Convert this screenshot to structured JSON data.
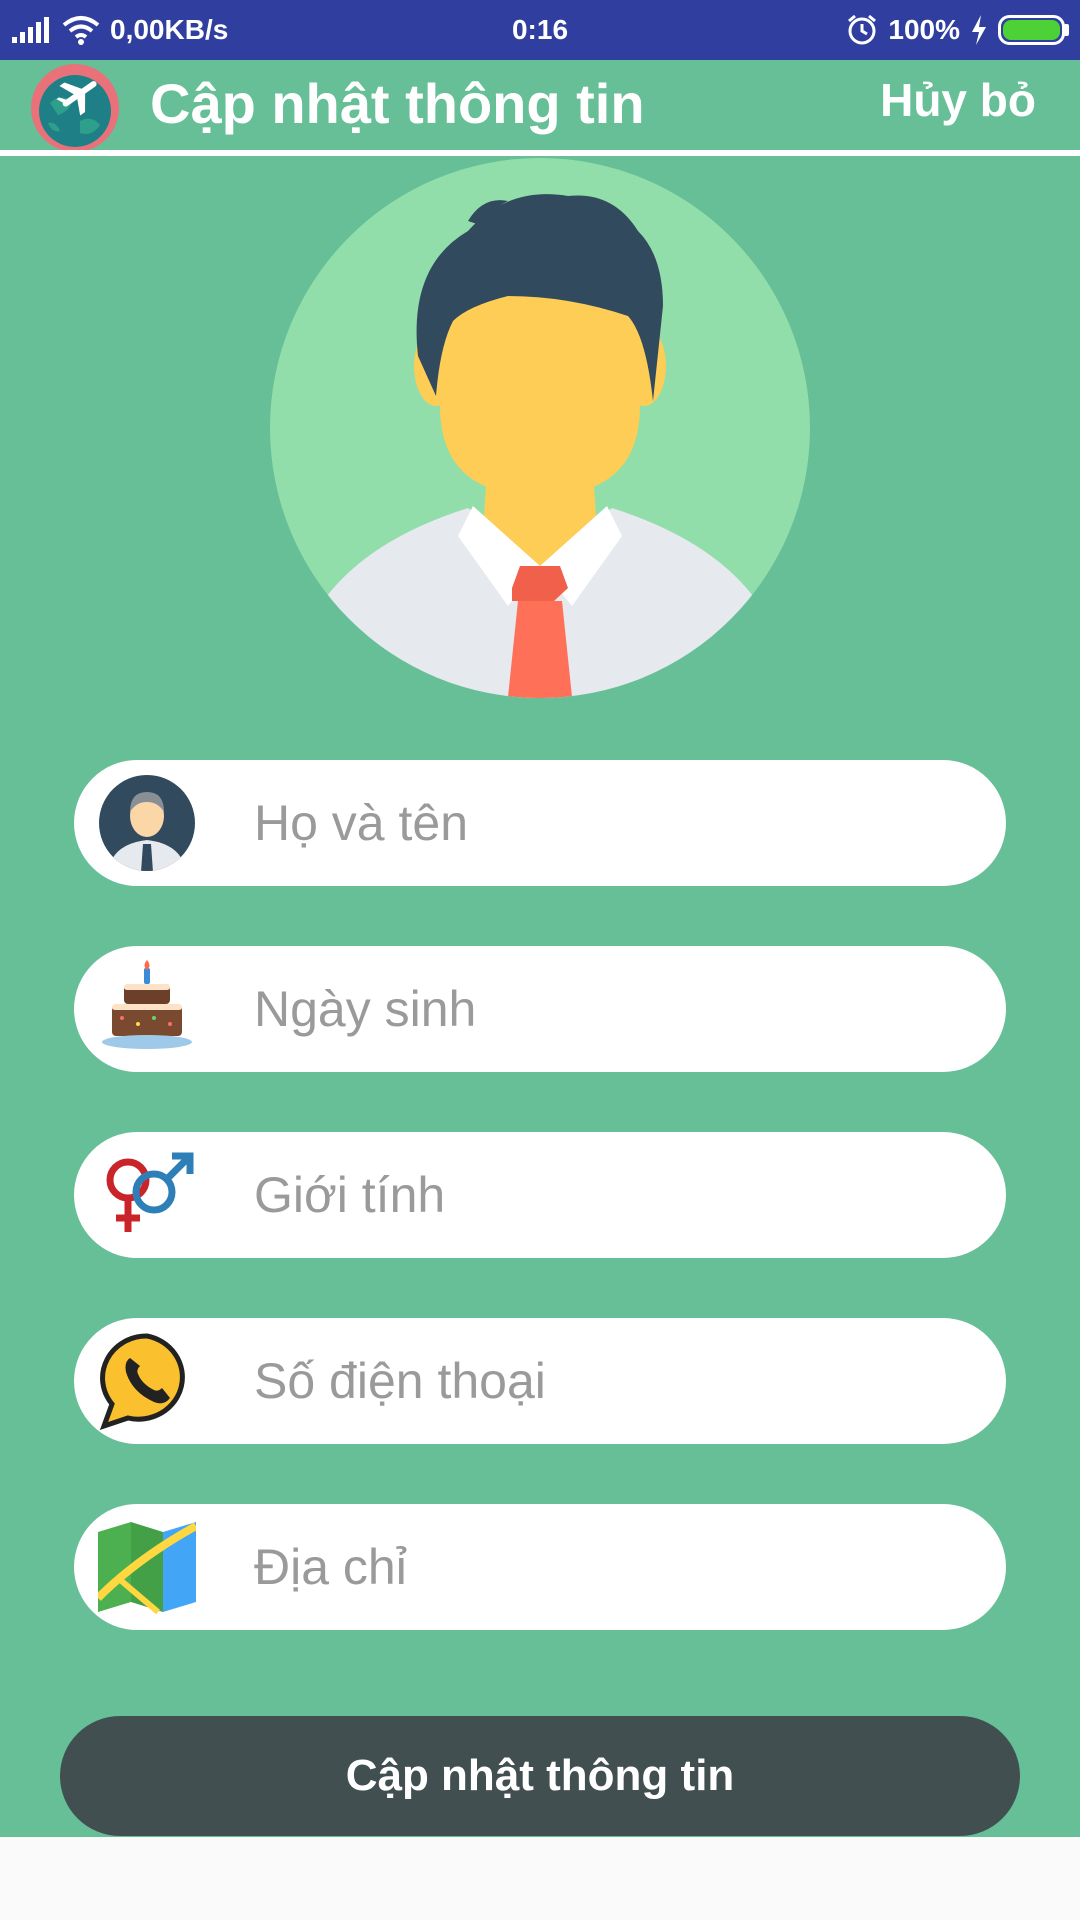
{
  "status_bar": {
    "network_speed": "0,00KB/s",
    "time": "0:16",
    "battery_percent": "100%",
    "icons": [
      "signal-icon",
      "wifi-icon",
      "alarm-icon",
      "charging-icon",
      "battery-icon"
    ]
  },
  "app_bar": {
    "title": "Cập nhật thông tin",
    "cancel_label": "Hủy bỏ",
    "logo_icon": "globe-airplane-logo"
  },
  "form": {
    "fields": [
      {
        "name": "full-name",
        "placeholder": "Họ và tên",
        "value": "",
        "icon": "person-icon"
      },
      {
        "name": "birthday",
        "placeholder": "Ngày sinh",
        "value": "",
        "icon": "birthday-cake-icon"
      },
      {
        "name": "gender",
        "placeholder": "Giới tính",
        "value": "",
        "icon": "gender-symbols-icon"
      },
      {
        "name": "phone",
        "placeholder": "Số điện thoại",
        "value": "",
        "icon": "phone-icon"
      },
      {
        "name": "address",
        "placeholder": "Địa chỉ",
        "value": "",
        "icon": "map-icon"
      }
    ],
    "submit_label": "Cập nhật thông tin"
  },
  "colors": {
    "status_bar": "#303f9f",
    "background": "#66bf97",
    "avatar_circle": "#91deaa",
    "submit_button": "#424f51",
    "field_background": "#ffffff",
    "placeholder_text": "#9a9a9a"
  }
}
